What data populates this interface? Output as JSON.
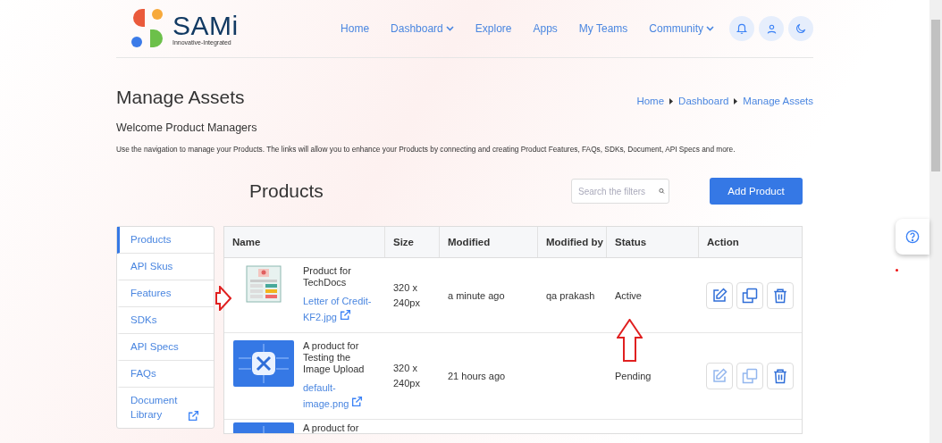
{
  "header": {
    "logo_name": "SAMi",
    "logo_tagline": "Innovative-Integrated",
    "nav": [
      {
        "label": "Home",
        "dropdown": false
      },
      {
        "label": "Dashboard",
        "dropdown": true
      },
      {
        "label": "Explore",
        "dropdown": false
      },
      {
        "label": "Apps",
        "dropdown": false
      },
      {
        "label": "My Teams",
        "dropdown": false
      },
      {
        "label": "Community",
        "dropdown": true
      }
    ],
    "icon_buttons": [
      {
        "kind": "bell"
      },
      {
        "kind": "user"
      },
      {
        "kind": "moon"
      }
    ]
  },
  "page": {
    "title": "Manage Assets",
    "breadcrumb": [
      "Home",
      "Dashboard",
      "Manage Assets"
    ],
    "welcome": "Welcome Product Managers",
    "description": "Use the navigation to manage your Products. The links will allow you to enhance your Products by connecting and creating Product Features, FAQs, SDKs, Document, API Specs and more."
  },
  "sidebar": {
    "items": [
      {
        "label": "Products",
        "selected": true,
        "external": false
      },
      {
        "label": "API Skus",
        "selected": false,
        "external": false
      },
      {
        "label": "Features",
        "selected": false,
        "external": false
      },
      {
        "label": "SDKs",
        "selected": false,
        "external": false
      },
      {
        "label": "API Specs",
        "selected": false,
        "external": false
      },
      {
        "label": "FAQs",
        "selected": false,
        "external": false
      },
      {
        "label": "Document Library",
        "selected": false,
        "external": true
      }
    ]
  },
  "products": {
    "title": "Products",
    "search": {
      "placeholder": "Search the filters"
    },
    "add_button": "Add Product",
    "columns": [
      "Name",
      "Size",
      "Modified",
      "Modified by",
      "Status",
      "Action"
    ],
    "rows": [
      {
        "kind": "document",
        "name": "Product for TechDocs",
        "file": "Letter of Credit-KF2.jpg",
        "size": "320 x 240px",
        "modified": "a minute ago",
        "modified_by": "qa prakash",
        "status": "Active",
        "actions": [
          {
            "kind": "edit",
            "disabled": false
          },
          {
            "kind": "copy",
            "disabled": false
          },
          {
            "kind": "delete",
            "disabled": false
          }
        ]
      },
      {
        "kind": "tools",
        "name": "A product for Testing the Image Upload",
        "file": "default-image.png",
        "size": "320 x 240px",
        "modified": "21 hours ago",
        "status": "Pending",
        "actions": [
          {
            "kind": "edit",
            "disabled": true
          },
          {
            "kind": "copy",
            "disabled": true
          },
          {
            "kind": "delete",
            "disabled": false
          }
        ]
      },
      {
        "kind": "tools",
        "name": "A product for"
      }
    ]
  }
}
